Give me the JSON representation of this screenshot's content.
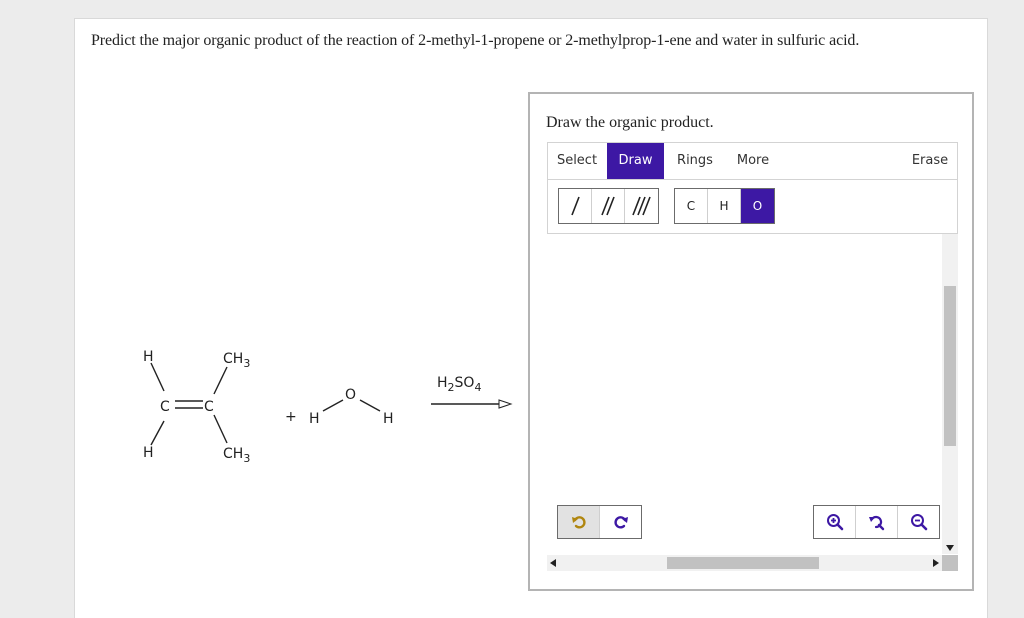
{
  "question": "Predict the major organic product of the reaction of 2-methyl-1-propene or 2-methylprop-1-ene and water in sulfuric acid.",
  "reaction": {
    "alkene": {
      "h_top": "H",
      "h_bottom": "H",
      "c_left": "C",
      "c_right": "C",
      "ch3_top": "CH",
      "ch3_bottom": "CH",
      "sub3": "3"
    },
    "plus": "+",
    "water": {
      "o": "O",
      "h_left": "H",
      "h_right": "H"
    },
    "reagent": {
      "main": "H",
      "sub2": "2",
      "so": "SO",
      "sub4": "4"
    }
  },
  "widget": {
    "prompt": "Draw the organic product.",
    "tabs": [
      {
        "label": "Select",
        "active": false
      },
      {
        "label": "Draw",
        "active": true
      },
      {
        "label": "Rings",
        "active": false
      },
      {
        "label": "More",
        "active": false
      },
      {
        "label": "Erase",
        "active": false
      }
    ],
    "bond_tools": [
      "/",
      "//",
      "///"
    ],
    "atom_tools": [
      {
        "label": "C",
        "active": false
      },
      {
        "label": "H",
        "active": false
      },
      {
        "label": "O",
        "active": true
      }
    ],
    "colors": {
      "accent": "#3d18a4",
      "icon_gold": "#b0860f",
      "icon_purple": "#3d18a4"
    },
    "icons": [
      "undo-icon",
      "redo-icon",
      "zoom-in-icon",
      "reset-zoom-icon",
      "zoom-out-icon"
    ]
  }
}
